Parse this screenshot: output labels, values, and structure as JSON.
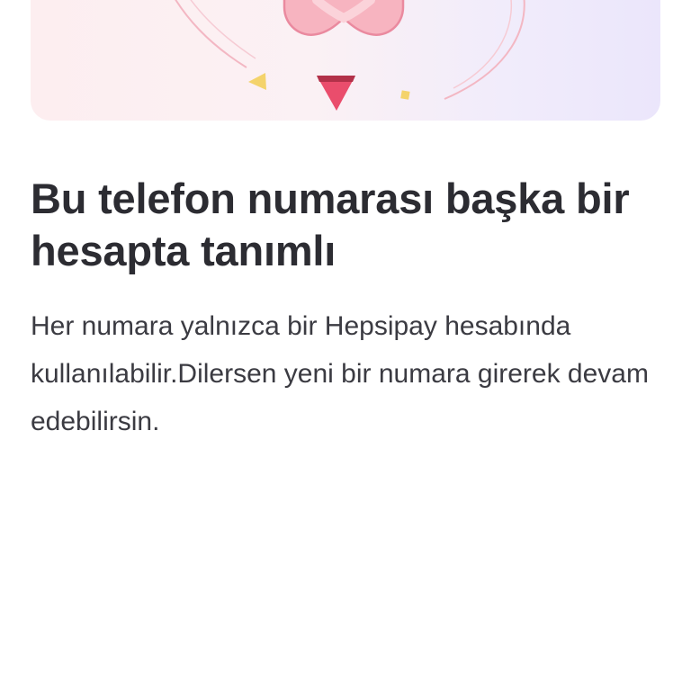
{
  "illustration": {
    "icon": "heart-with-confetti-illustration",
    "colors": {
      "heart": "#f7b4c0",
      "heart_outline": "#ea8a9f",
      "triangle": "#ea4d6c",
      "triangle_dark": "#b23149",
      "confetti": "#f4d36b",
      "swirl": "#f3b7c3"
    }
  },
  "content": {
    "title": "Bu telefon numarası başka bir hesapta tanımlı",
    "description": "Her numara yalnızca bir Hepsipay hesabında kullanılabilir.Dilersen yeni bir numara girerek devam edebilirsin."
  }
}
